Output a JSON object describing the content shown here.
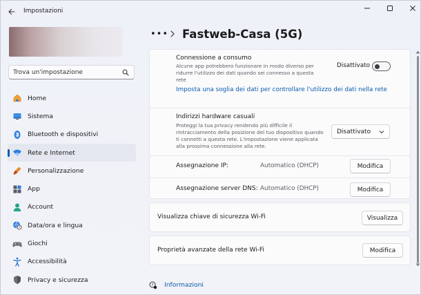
{
  "window": {
    "app_title": "Impostazioni"
  },
  "sidebar": {
    "search_placeholder": "Trova un'impostazione",
    "items": [
      {
        "label": "Home",
        "icon": "home-icon"
      },
      {
        "label": "Sistema",
        "icon": "system-icon"
      },
      {
        "label": "Bluetooth e dispositivi",
        "icon": "bluetooth-icon"
      },
      {
        "label": "Rete e Internet",
        "icon": "wifi-icon",
        "active": true
      },
      {
        "label": "Personalizzazione",
        "icon": "brush-icon"
      },
      {
        "label": "App",
        "icon": "apps-icon"
      },
      {
        "label": "Account",
        "icon": "account-icon"
      },
      {
        "label": "Data/ora e lingua",
        "icon": "globe-clock-icon"
      },
      {
        "label": "Giochi",
        "icon": "gamepad-icon"
      },
      {
        "label": "Accessibilità",
        "icon": "accessibility-icon"
      },
      {
        "label": "Privacy e sicurezza",
        "icon": "shield-icon"
      }
    ]
  },
  "header": {
    "breadcrumb_more": "•••",
    "title": "Fastweb-Casa (5G)"
  },
  "content": {
    "metered": {
      "title": "Connessione a consumo",
      "description": "Alcune app potrebbero funzionare in modo diverso per ridurre l'utilizzo dei dati quando sei connesso a questa rete",
      "toggle_label": "Disattivato",
      "toggle_on": false,
      "link": "Imposta una soglia dei dati per controllare l'utilizzo dei dati nella rete"
    },
    "random_hw": {
      "title": "Indirizzi hardware casuali",
      "description": "Proteggi la tua privacy rendendo più difficile il rintracciamento della posizione del tuo dispositivo quando ti connetti a questa rete. L'impostazione viene applicata alla prossima connessione alla rete.",
      "dropdown_value": "Disattivato"
    },
    "ip": {
      "label": "Assegnazione IP:",
      "value": "Automatico (DHCP)",
      "button": "Modifica"
    },
    "dns": {
      "label": "Assegnazione server DNS:",
      "value": "Automatico (DHCP)",
      "button": "Modifica"
    },
    "security_key": {
      "label": "Visualizza chiave di sicurezza Wi-Fi",
      "button": "Visualizza"
    },
    "advanced": {
      "label": "Proprietà avanzate della rete Wi-Fi",
      "button": "Modifica"
    }
  },
  "footer": {
    "info_link": "Informazioni"
  },
  "colors": {
    "accent": "#0b5cad",
    "background": "#f1f3f9",
    "card": "#fbfbfc"
  }
}
